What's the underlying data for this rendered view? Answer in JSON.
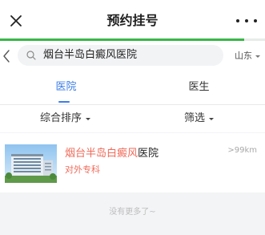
{
  "header": {
    "title": "预约挂号",
    "close_icon": "close-icon",
    "more_icon": "more-icon",
    "progress": 0.92,
    "progress_color": "#37b848"
  },
  "search": {
    "back_icon": "back-icon",
    "search_icon": "search-icon",
    "value": "烟台半岛白癜风医院",
    "region": "山东"
  },
  "tabs": [
    {
      "label": "医院",
      "active": true
    },
    {
      "label": "医生",
      "active": false
    }
  ],
  "filters": [
    {
      "label": "综合排序"
    },
    {
      "label": "筛选"
    }
  ],
  "results": [
    {
      "name_highlight": "烟台半岛白癜风",
      "name_rest": "医院",
      "tag": "对外专科",
      "distance": ">99km"
    }
  ],
  "footer": {
    "no_more": "没有更多了~"
  },
  "colors": {
    "accent": "#3b7de8",
    "highlight": "#f06b5a"
  }
}
